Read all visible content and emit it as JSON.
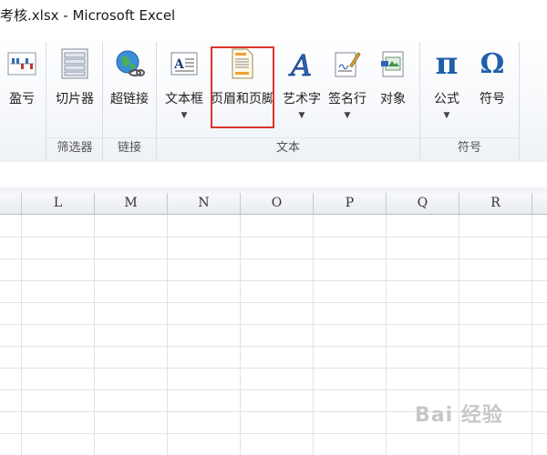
{
  "window": {
    "title": "考核.xlsx - Microsoft Excel"
  },
  "ribbon": {
    "groups": [
      {
        "name": "sparklines",
        "label": "",
        "buttons": [
          {
            "label": "盈亏",
            "icon": "win-loss-sparkline-icon"
          }
        ]
      },
      {
        "name": "filter",
        "label": "筛选器",
        "buttons": [
          {
            "label": "切片器",
            "icon": "slicer-icon"
          }
        ]
      },
      {
        "name": "links",
        "label": "链接",
        "buttons": [
          {
            "label": "超链接",
            "icon": "hyperlink-globe-icon"
          }
        ]
      },
      {
        "name": "text",
        "label": "文本",
        "buttons": [
          {
            "label": "文本框",
            "icon": "text-box-icon",
            "dropdown": true
          },
          {
            "label": "页眉和页脚",
            "icon": "header-footer-icon",
            "dropdown": false
          },
          {
            "label": "艺术字",
            "icon": "wordart-icon",
            "dropdown": true
          },
          {
            "label": "签名行",
            "icon": "signature-line-icon",
            "dropdown": true
          },
          {
            "label": "对象",
            "icon": "object-icon",
            "dropdown": false
          }
        ]
      },
      {
        "name": "symbols",
        "label": "符号",
        "buttons": [
          {
            "label": "公式",
            "icon": "equation-pi-icon",
            "dropdown": true,
            "glyph": "π"
          },
          {
            "label": "符号",
            "icon": "symbol-omega-icon",
            "dropdown": false,
            "glyph": "Ω"
          }
        ]
      }
    ]
  },
  "sheet": {
    "columns": [
      "L",
      "M",
      "N",
      "O",
      "P",
      "Q",
      "R"
    ]
  },
  "colors": {
    "highlight": "#d9362b",
    "accent": "#1f5fa8"
  },
  "watermark": "Bai 经验"
}
